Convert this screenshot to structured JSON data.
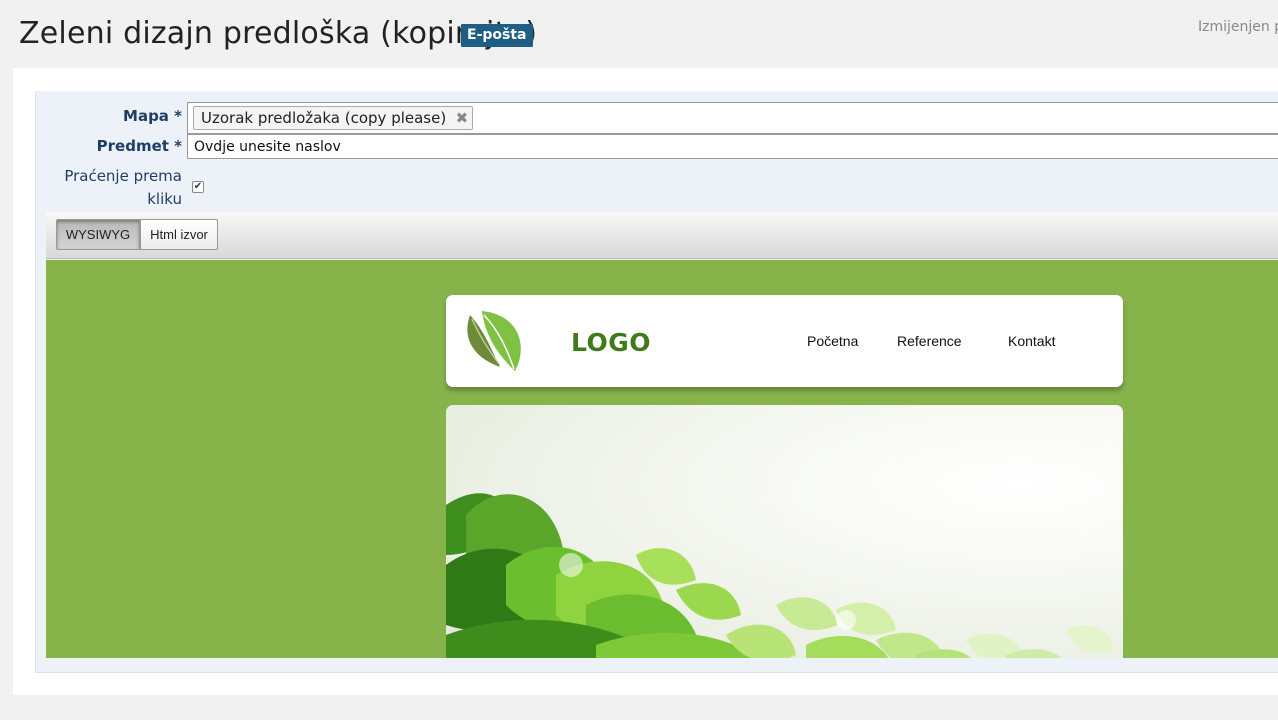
{
  "header": {
    "title": "Zeleni dizajn predloška (kopirajte)",
    "badge": "E-pošta",
    "modified": "Izmijenjen pr"
  },
  "form": {
    "mapa_label": "Mapa *",
    "mapa_tag": "Uzorak predložaka (copy please)",
    "mapa_remove": "✖",
    "predmet_label": "Predmet *",
    "predmet_value": "Ovdje unesite naslov",
    "click_tracking_label_1": "Praćenje prema",
    "click_tracking_label_2": "kliku",
    "click_tracking_checked": "✔"
  },
  "editor": {
    "wysiwyg_label": "WYSIWYG",
    "html_label": "Html izvor"
  },
  "template": {
    "logo_text": "LOGO",
    "nav": [
      "Početna",
      "Reference",
      "Kontakt"
    ],
    "background_color": "#86b44b"
  }
}
